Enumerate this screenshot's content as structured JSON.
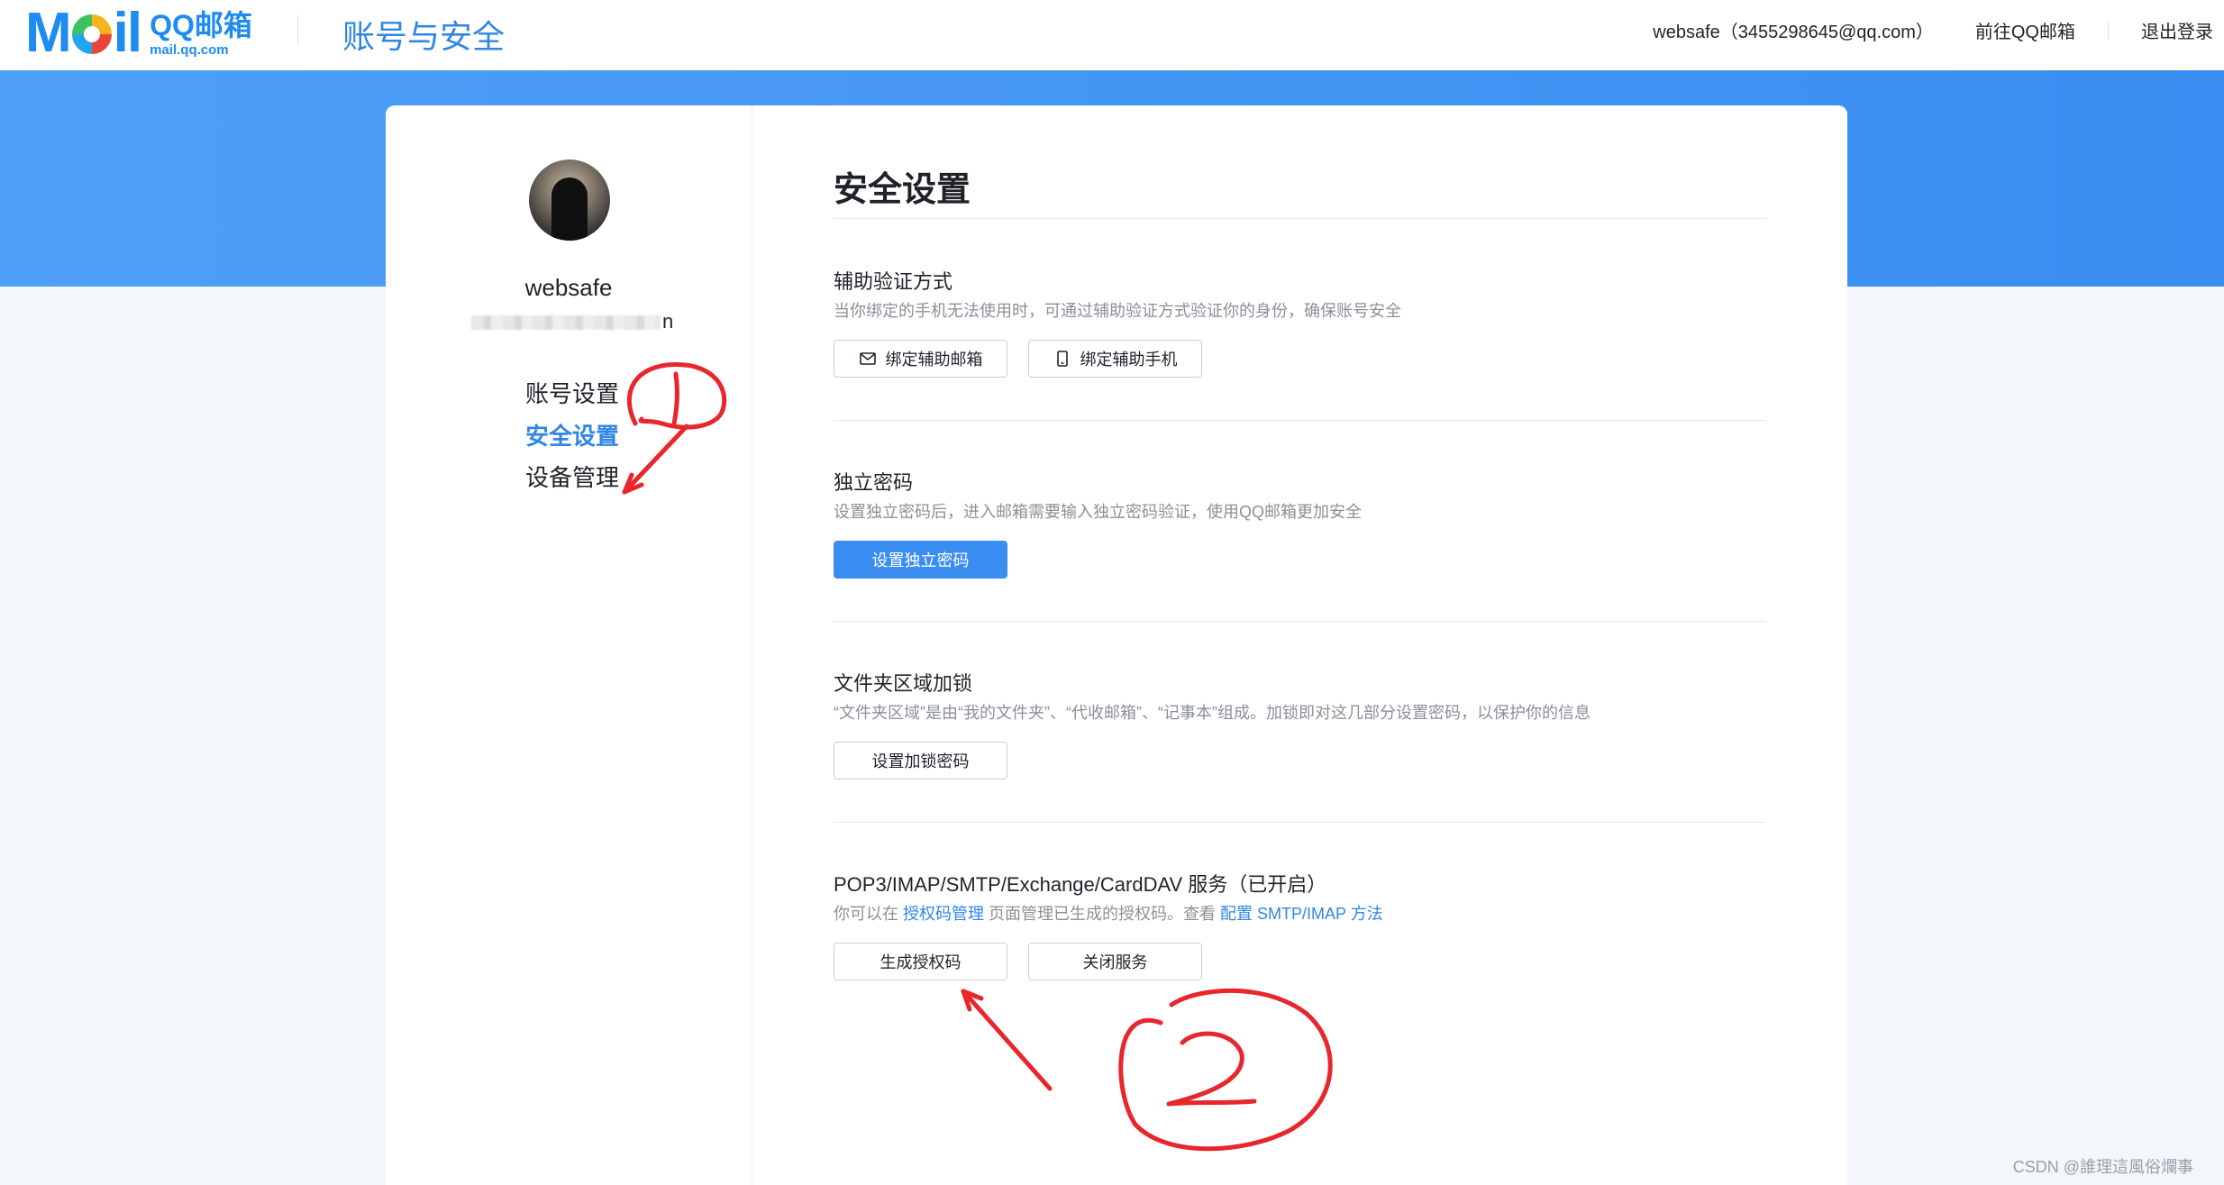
{
  "header": {
    "logo_mail": "Mil",
    "logo_cn": "QQ邮箱",
    "logo_url": "mail.qq.com",
    "page_title": "账号与安全",
    "user": "websafe（3455298645@qq.com）",
    "goto": "前往QQ邮箱",
    "logout": "退出登录"
  },
  "sidebar": {
    "name": "websafe",
    "mail_tail": "n",
    "items": [
      {
        "label": "账号设置"
      },
      {
        "label": "安全设置"
      },
      {
        "label": "设备管理"
      }
    ]
  },
  "main": {
    "title": "安全设置",
    "sections": [
      {
        "title": "辅助验证方式",
        "desc": "当你绑定的手机无法使用时，可通过辅助验证方式验证你的身份，确保账号安全",
        "buttons": [
          "绑定辅助邮箱",
          "绑定辅助手机"
        ]
      },
      {
        "title": "独立密码",
        "desc": "设置独立密码后，进入邮箱需要输入独立密码验证，使用QQ邮箱更加安全",
        "buttons": [
          "设置独立密码"
        ]
      },
      {
        "title": "文件夹区域加锁",
        "desc": "“文件夹区域”是由“我的文件夹”、“代收邮箱”、“记事本”组成。加锁即对这几部分设置密码，以保护你的信息",
        "buttons": [
          "设置加锁密码"
        ]
      },
      {
        "title": "POP3/IMAP/SMTP/Exchange/CardDAV 服务（已开启）",
        "desc_parts": {
          "p1": "你可以在 ",
          "link1": "授权码管理",
          "p2": " 页面管理已生成的授权码。查看 ",
          "link2": "配置 SMTP/IMAP 方法"
        },
        "buttons": [
          "生成授权码",
          "关闭服务"
        ]
      }
    ]
  },
  "watermark": "CSDN @誰理這風俗爛事",
  "colors": {
    "accent": "#2f86e6",
    "banner": "#3b8ef1",
    "annotation": "#e8262c"
  }
}
